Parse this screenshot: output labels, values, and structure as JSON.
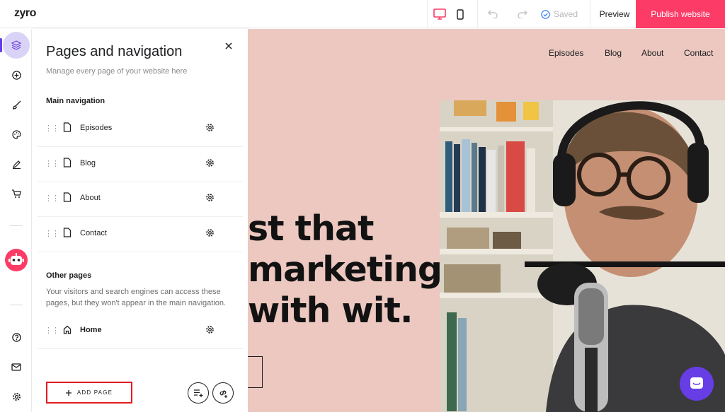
{
  "app": {
    "logo": "zyro",
    "saved_label": "Saved",
    "preview_label": "Preview",
    "publish_label": "Publish website"
  },
  "panel": {
    "title": "Pages and navigation",
    "subtitle": "Manage every page of your website here",
    "main_nav_heading": "Main navigation",
    "main_nav_items": [
      "Episodes",
      "Blog",
      "About",
      "Contact"
    ],
    "other_heading": "Other pages",
    "other_description": "Your visitors and search engines can access these pages, but they won't appear in the main navigation.",
    "other_items": [
      "Home"
    ],
    "add_page_label": "ADD PAGE"
  },
  "site": {
    "nav": [
      "Episodes",
      "Blog",
      "About",
      "Contact"
    ],
    "hero_lines": [
      "st that",
      "marketing",
      "with wit."
    ]
  },
  "colors": {
    "accent": "#673de6",
    "publish": "#fc3b66",
    "canvas_bg": "#ecc8c0",
    "highlight": "#e31b23"
  },
  "icons": {
    "rail": [
      "layers-icon",
      "add-circle-icon",
      "brush-icon",
      "palette-icon",
      "pen-icon",
      "cart-icon",
      "robot-icon",
      "help-icon",
      "mail-icon",
      "settings-icon"
    ]
  }
}
